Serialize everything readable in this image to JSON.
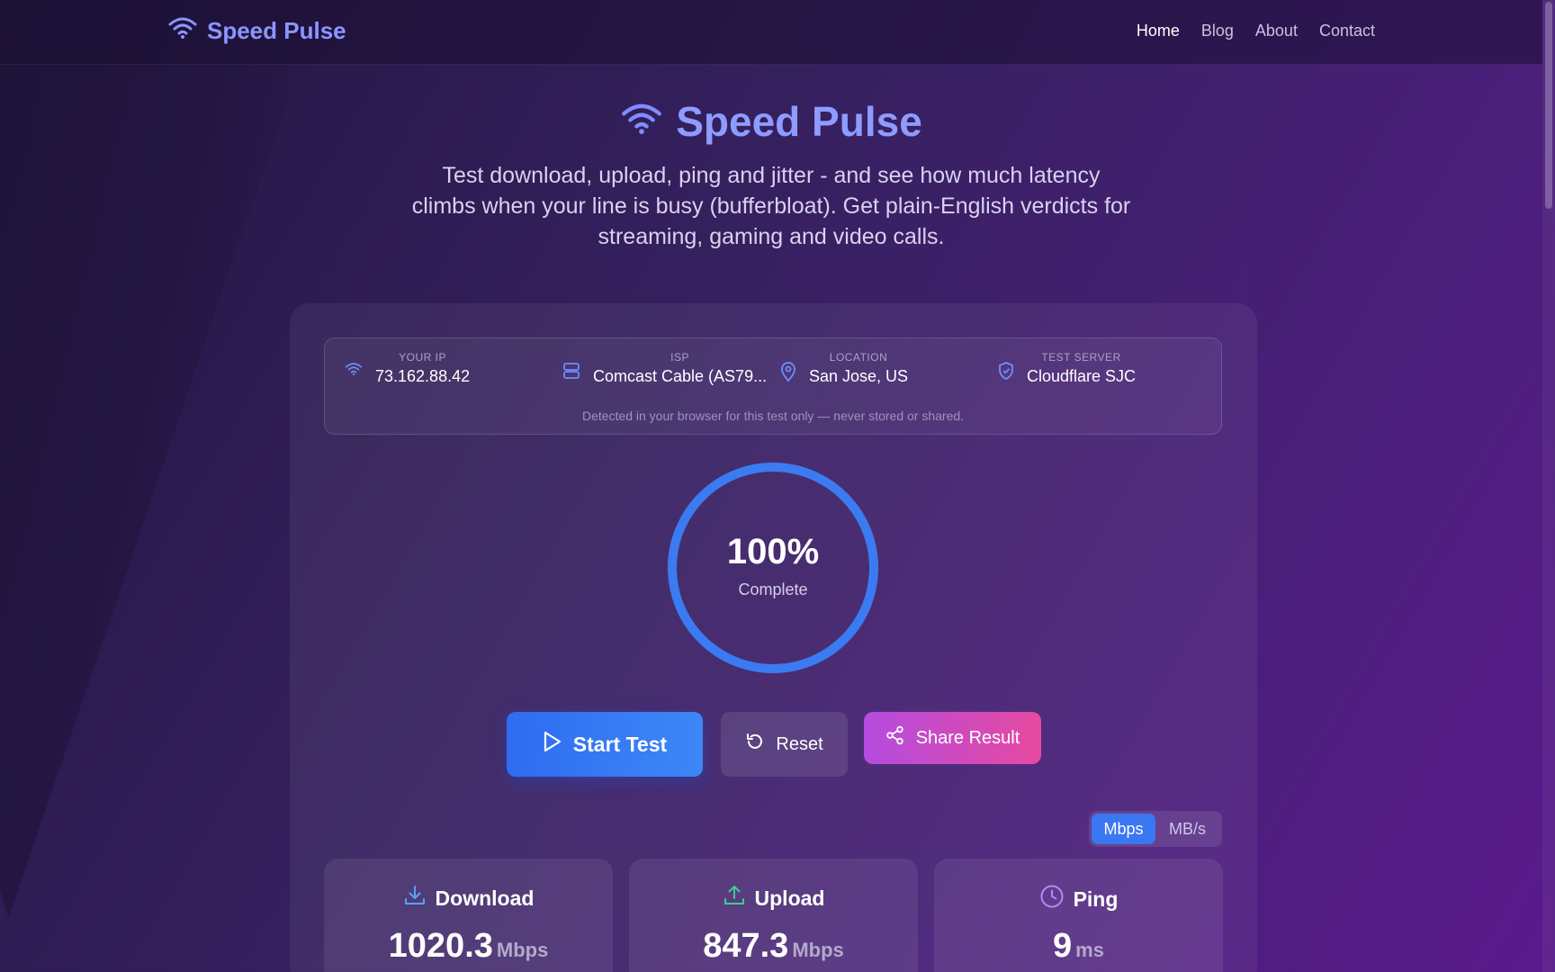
{
  "brand": {
    "name": "Speed Pulse",
    "icon": "wifi-icon",
    "color": "#8a95ff"
  },
  "nav": [
    {
      "label": "Home",
      "active": true
    },
    {
      "label": "Blog",
      "active": false
    },
    {
      "label": "About",
      "active": false
    },
    {
      "label": "Contact",
      "active": false
    }
  ],
  "hero": {
    "title": "Speed Pulse",
    "subtitle": "Test download, upload, ping and jitter - and see how much latency climbs when your line is busy (bufferbloat). Get plain-English verdicts for streaming, gaming and video calls."
  },
  "info": {
    "ip": {
      "label": "YOUR IP",
      "value": "73.162.88.42",
      "icon": "wifi-icon"
    },
    "isp": {
      "label": "ISP",
      "value": "Comcast Cable (AS79...",
      "icon": "server-icon"
    },
    "location": {
      "label": "LOCATION",
      "value": "San Jose, US",
      "icon": "map-pin-icon"
    },
    "server": {
      "label": "TEST SERVER",
      "value": "Cloudflare SJC",
      "icon": "shield-icon"
    },
    "note": "Detected in your browser for this test only — never stored or shared."
  },
  "gauge": {
    "percent_text": "100%",
    "label": "Complete",
    "progress": 1.0,
    "color": "#3b7bf2"
  },
  "buttons": {
    "start": "Start Test",
    "reset": "Reset",
    "share": "Share Result"
  },
  "units": {
    "options": [
      "Mbps",
      "MB/s"
    ],
    "selected": "Mbps"
  },
  "metrics": {
    "download": {
      "label": "Download",
      "value": "1020.3",
      "unit": "Mbps",
      "icon": "download-icon",
      "color": "#5aa0ff"
    },
    "upload": {
      "label": "Upload",
      "value": "847.3",
      "unit": "Mbps",
      "icon": "upload-icon",
      "color": "#3ccf8e"
    },
    "ping": {
      "label": "Ping",
      "value": "9",
      "unit": "ms",
      "icon": "clock-icon",
      "color": "#b088ff"
    }
  }
}
